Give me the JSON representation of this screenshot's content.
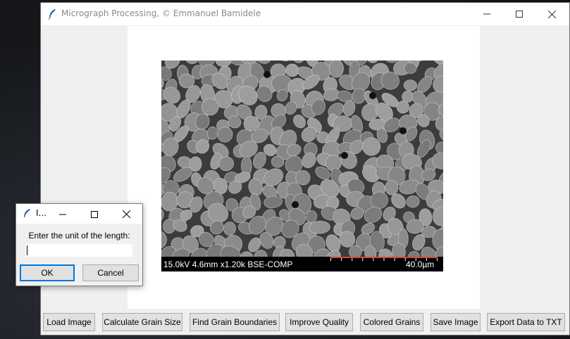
{
  "window": {
    "title": "Micrograph Processing,  © Emmanuel Bamidele",
    "icon": "feather-icon"
  },
  "micrograph": {
    "info_text": "15.0kV 4.6mm x1.20k BSE-COMP",
    "scale_text": "40.0µm",
    "scale_color": "#d04a3a"
  },
  "buttons": [
    "Load Image",
    "Calculate Grain Size",
    "Find Grain Boundaries",
    "Improve Quality",
    "Colored Grains",
    "Save Image",
    "Export Data to TXT"
  ],
  "dialog": {
    "title": "I...",
    "prompt": "Enter the unit of the length:",
    "input_value": "",
    "ok_label": "OK",
    "cancel_label": "Cancel"
  },
  "colors": {
    "accent": "#0078d7",
    "window_bg": "#f0f0f0",
    "canvas_bg": "#ffffff"
  }
}
